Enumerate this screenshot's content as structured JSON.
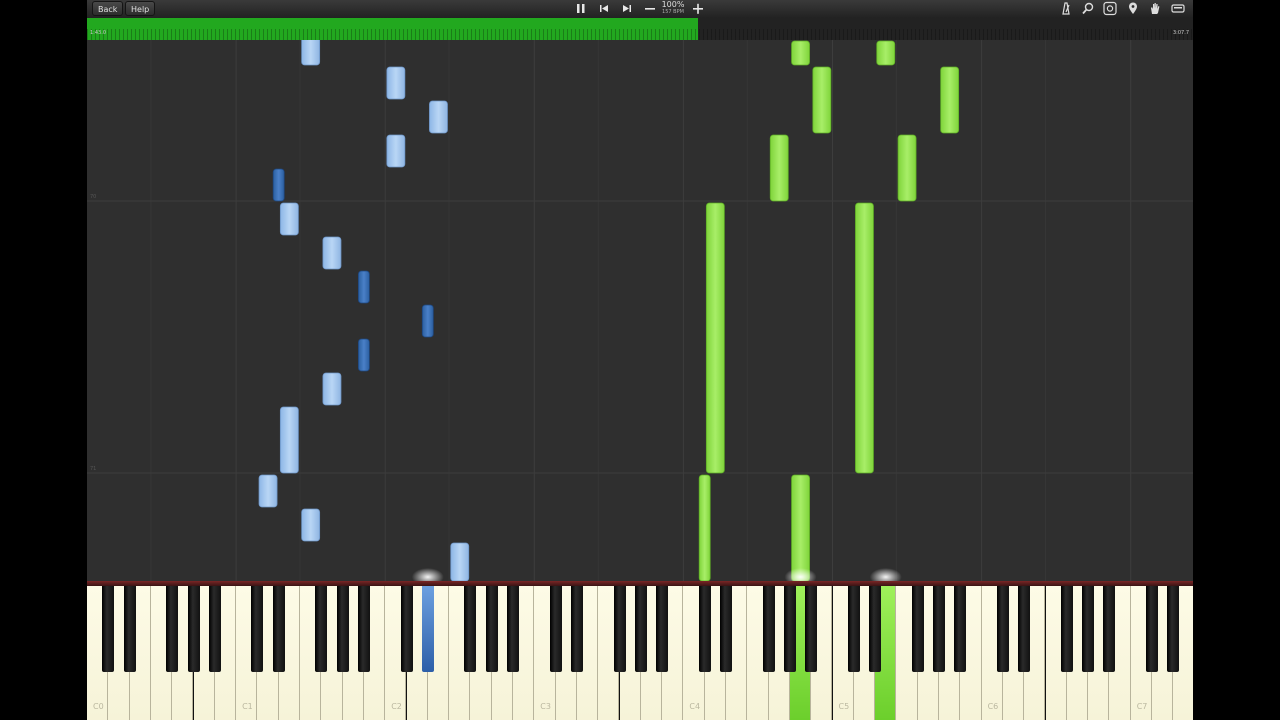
{
  "toolbar": {
    "back_label": "Back",
    "help_label": "Help",
    "zoom_percent": "100%",
    "tempo": "157 BPM",
    "icons": [
      "pause-icon",
      "previous-icon",
      "next-icon",
      "zoom-out-icon",
      "zoom-in-icon",
      "metronome-icon",
      "search-icon",
      "settings-icon",
      "marker-icon",
      "hand-icon",
      "keyboard-icon"
    ]
  },
  "progress": {
    "fraction": 0.552,
    "elapsed": "1:43.0",
    "total": "3:07.7",
    "color": "#22a81f"
  },
  "roll": {
    "measure_labels": [
      "71",
      "70"
    ],
    "left_hand_color": "#a9c9ee",
    "right_hand_color": "#99e45a",
    "notes": [
      {
        "hand": "left",
        "key": "F2",
        "pos": 0,
        "length": 38,
        "active": true
      },
      {
        "hand": "left",
        "key": "F1",
        "pos": 40,
        "length": 32
      },
      {
        "hand": "left",
        "key": "D1",
        "pos": 74,
        "length": 32
      },
      {
        "hand": "left",
        "key": "E1",
        "pos": 108,
        "length": 66
      },
      {
        "hand": "left",
        "key": "G1",
        "pos": 176,
        "length": 32
      },
      {
        "hand": "left",
        "key": "A#1",
        "pos": 210,
        "length": 32
      },
      {
        "hand": "left",
        "key": "D#2",
        "pos": 244,
        "length": 32,
        "active": true
      },
      {
        "hand": "left",
        "key": "A#1",
        "pos": 278,
        "length": 32
      },
      {
        "hand": "left",
        "key": "G1",
        "pos": 312,
        "length": 32
      },
      {
        "hand": "left",
        "key": "E1",
        "pos": 346,
        "length": 32
      },
      {
        "hand": "left",
        "key": "D#1",
        "pos": 380,
        "length": 32
      },
      {
        "hand": "left",
        "key": "C2",
        "pos": 414,
        "length": 32
      },
      {
        "hand": "left",
        "key": "E2",
        "pos": 448,
        "length": 32
      },
      {
        "hand": "left",
        "key": "C2",
        "pos": 482,
        "length": 32
      },
      {
        "hand": "left",
        "key": "F1",
        "pos": 516,
        "length": 32
      },
      {
        "hand": "left",
        "key": "D#2",
        "pos": 550,
        "length": 24,
        "active": true
      },
      {
        "hand": "right",
        "key": "C#4",
        "pos": 0,
        "length": 106
      },
      {
        "hand": "right",
        "key": "A4",
        "pos": 0,
        "length": 106
      },
      {
        "hand": "right",
        "key": "D4",
        "pos": 108,
        "length": 270
      },
      {
        "hand": "right",
        "key": "D5",
        "pos": 108,
        "length": 270
      },
      {
        "hand": "right",
        "key": "G4",
        "pos": 380,
        "length": 66
      },
      {
        "hand": "right",
        "key": "F5",
        "pos": 380,
        "length": 66
      },
      {
        "hand": "right",
        "key": "B4",
        "pos": 448,
        "length": 66
      },
      {
        "hand": "right",
        "key": "A5",
        "pos": 448,
        "length": 66
      },
      {
        "hand": "right",
        "key": "A4",
        "pos": 516,
        "length": 24
      },
      {
        "hand": "right",
        "key": "E5",
        "pos": 516,
        "length": 24
      }
    ]
  },
  "keyboard": {
    "octave_labels": [
      "C0",
      "C1",
      "C2",
      "C3",
      "C4",
      "C5",
      "C6",
      "C7"
    ],
    "pressed": [
      {
        "key": "D#2",
        "hand": "left"
      },
      {
        "key": "A4",
        "hand": "right"
      },
      {
        "key": "E5",
        "hand": "right"
      }
    ]
  }
}
